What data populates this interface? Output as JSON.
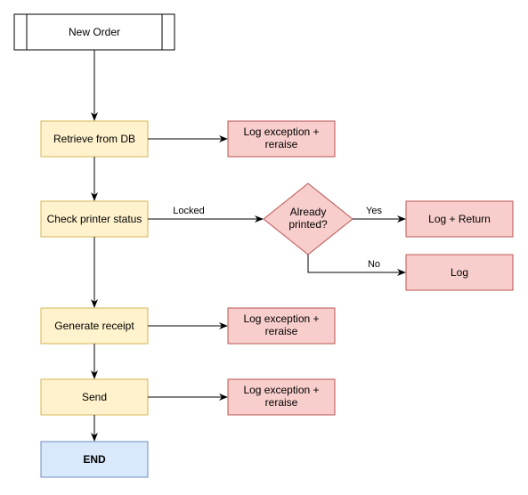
{
  "chart_data": {
    "type": "flowchart",
    "title": "",
    "nodes": [
      {
        "id": "start",
        "label": "New Order",
        "shape": "terminator",
        "style": "white"
      },
      {
        "id": "retrieve",
        "label": "Retrieve from DB",
        "shape": "rect",
        "style": "yellow"
      },
      {
        "id": "check",
        "label": "Check printer status",
        "shape": "rect",
        "style": "yellow"
      },
      {
        "id": "generate",
        "label": "Generate receipt",
        "shape": "rect",
        "style": "yellow"
      },
      {
        "id": "send",
        "label": "Send",
        "shape": "rect",
        "style": "yellow"
      },
      {
        "id": "end",
        "label": "END",
        "shape": "rect",
        "style": "blue",
        "bold": true
      },
      {
        "id": "err_retrieve",
        "label": "Log exception + reraise",
        "shape": "rect",
        "style": "red"
      },
      {
        "id": "decision",
        "label": "Already printed?",
        "shape": "diamond",
        "style": "red"
      },
      {
        "id": "logreturn",
        "label": "Log + Return",
        "shape": "rect",
        "style": "red"
      },
      {
        "id": "log",
        "label": "Log",
        "shape": "rect",
        "style": "red"
      },
      {
        "id": "err_generate",
        "label": "Log exception + reraise",
        "shape": "rect",
        "style": "red"
      },
      {
        "id": "err_send",
        "label": "Log exception + reraise",
        "shape": "rect",
        "style": "red"
      }
    ],
    "edges": [
      {
        "from": "start",
        "to": "retrieve",
        "label": ""
      },
      {
        "from": "retrieve",
        "to": "check",
        "label": ""
      },
      {
        "from": "check",
        "to": "generate",
        "label": ""
      },
      {
        "from": "generate",
        "to": "send",
        "label": ""
      },
      {
        "from": "send",
        "to": "end",
        "label": ""
      },
      {
        "from": "retrieve",
        "to": "err_retrieve",
        "label": ""
      },
      {
        "from": "check",
        "to": "decision",
        "label": "Locked"
      },
      {
        "from": "decision",
        "to": "logreturn",
        "label": "Yes"
      },
      {
        "from": "decision",
        "to": "log",
        "label": "No"
      },
      {
        "from": "generate",
        "to": "err_generate",
        "label": ""
      },
      {
        "from": "send",
        "to": "err_send",
        "label": ""
      }
    ]
  },
  "labels": {
    "start": "New Order",
    "retrieve": "Retrieve from DB",
    "check": "Check printer status",
    "generate": "Generate receipt",
    "send": "Send",
    "end": "END",
    "err_retrieve_l1": "Log exception +",
    "err_retrieve_l2": "reraise",
    "decision_l1": "Already",
    "decision_l2": "printed?",
    "logreturn": "Log + Return",
    "log": "Log",
    "err_generate_l1": "Log exception +",
    "err_generate_l2": "reraise",
    "err_send_l1": "Log exception +",
    "err_send_l2": "reraise",
    "edge_locked": "Locked",
    "edge_yes": "Yes",
    "edge_no": "No"
  }
}
